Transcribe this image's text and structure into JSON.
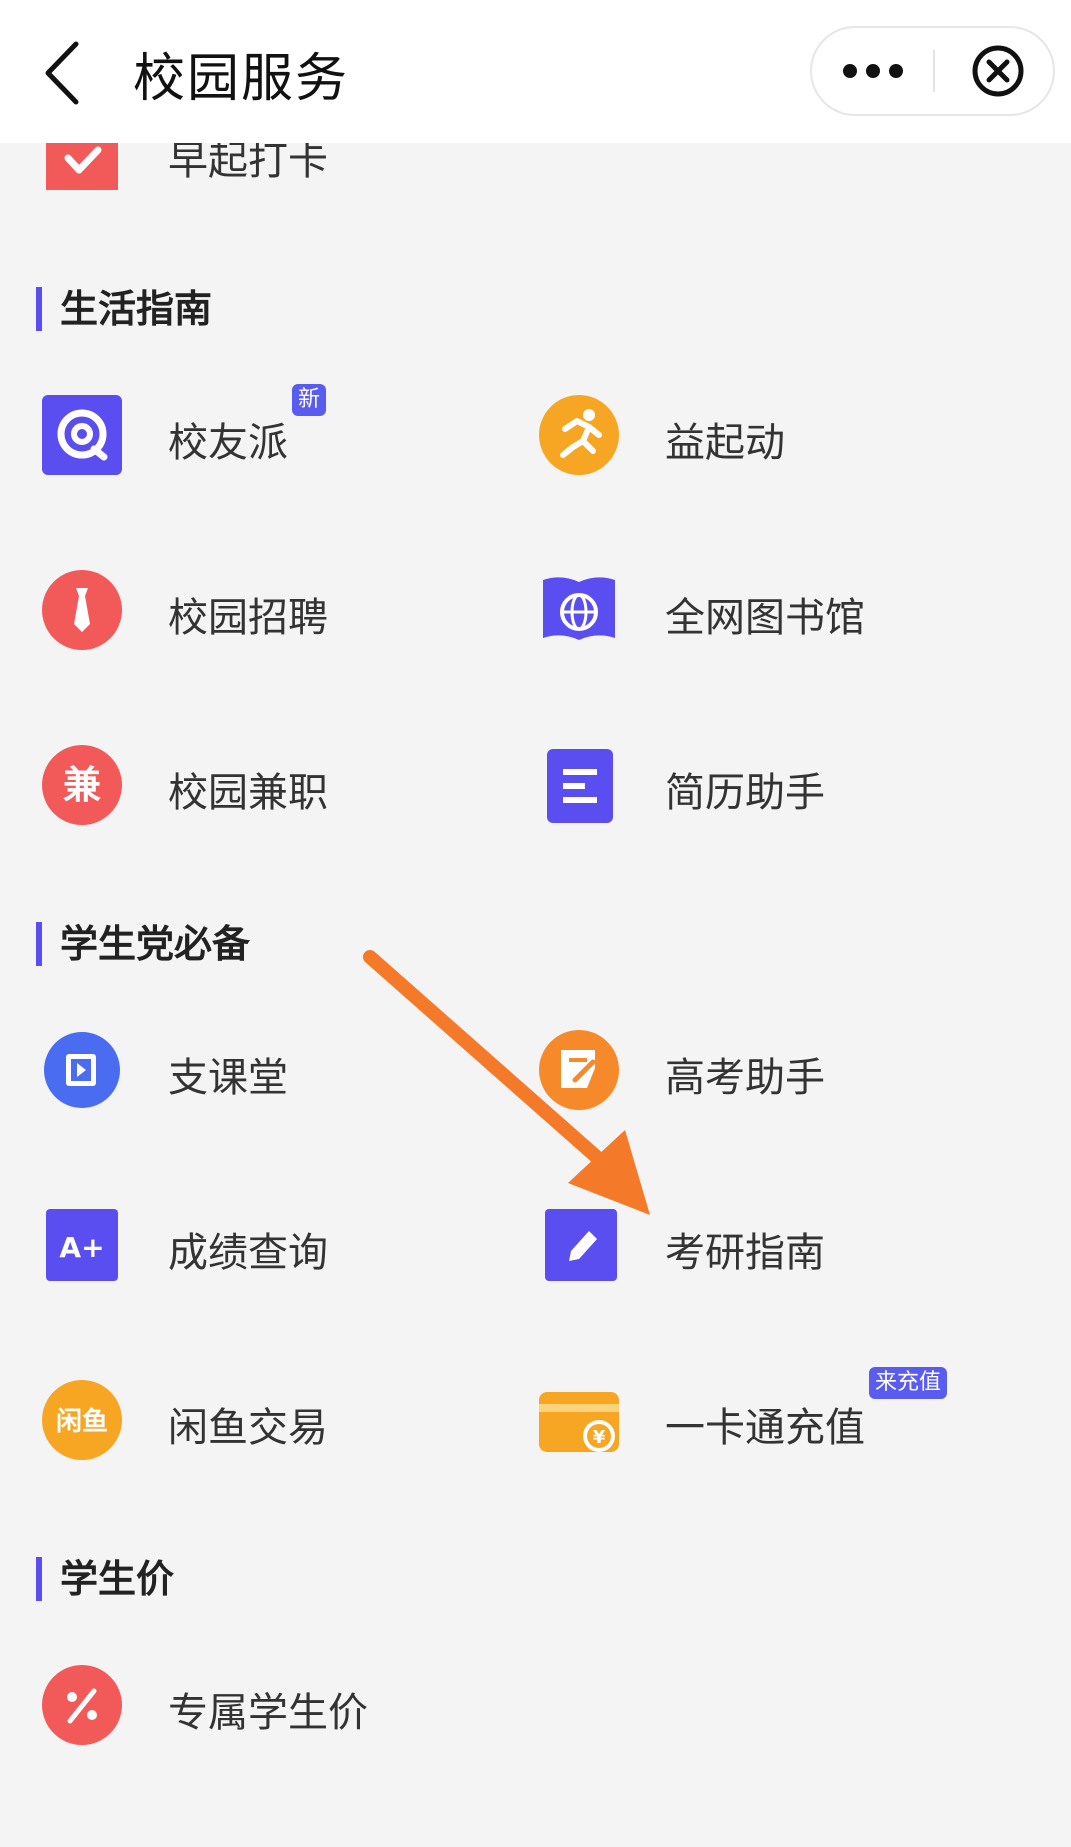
{
  "header": {
    "title": "校园服务",
    "back_icon": "chevron-left-icon",
    "more_icon": "more-dots-icon",
    "close_icon": "close-circle-icon"
  },
  "partial_item": {
    "label": "早起打卡",
    "icon": "checkmark-icon",
    "color": "#f25a5a"
  },
  "sections": [
    {
      "title": "生活指南",
      "items": [
        {
          "label": "校友派",
          "icon": "chat-q-icon",
          "badge": "新",
          "color": "#5a4ef0"
        },
        {
          "label": "益起动",
          "icon": "runner-icon",
          "color": "#f6a623"
        },
        {
          "label": "校园招聘",
          "icon": "necktie-icon",
          "color": "#f25a5a"
        },
        {
          "label": "全网图书馆",
          "icon": "globe-book-icon",
          "color": "#5a4ef0"
        },
        {
          "label": "校园兼职",
          "icon": "jian-char-icon",
          "icon_text": "兼",
          "color": "#f25a5a"
        },
        {
          "label": "简历助手",
          "icon": "resume-lines-icon",
          "color": "#5a4ef0"
        }
      ]
    },
    {
      "title": "学生党必备",
      "items": [
        {
          "label": "支课堂",
          "icon": "video-book-icon",
          "color": "#4a6cf0"
        },
        {
          "label": "高考助手",
          "icon": "exam-paper-icon",
          "color": "#f68a2a"
        },
        {
          "label": "成绩查询",
          "icon": "a-plus-icon",
          "icon_text": "A+",
          "color": "#5a4ef0"
        },
        {
          "label": "考研指南",
          "icon": "pencil-icon",
          "color": "#5a4ef0"
        },
        {
          "label": "闲鱼交易",
          "icon": "xianyu-logo-icon",
          "icon_text": "闲鱼",
          "color": "#f6a623"
        },
        {
          "label": "一卡通充值",
          "icon": "card-yuan-icon",
          "badge": "来充值",
          "color": "#f6a623"
        }
      ]
    },
    {
      "title": "学生价",
      "items": [
        {
          "label": "专属学生价",
          "icon": "percent-icon",
          "color": "#f25a5a"
        }
      ]
    }
  ],
  "annotation": {
    "type": "arrow",
    "color": "#f47a2a",
    "points_to": "考研指南"
  }
}
